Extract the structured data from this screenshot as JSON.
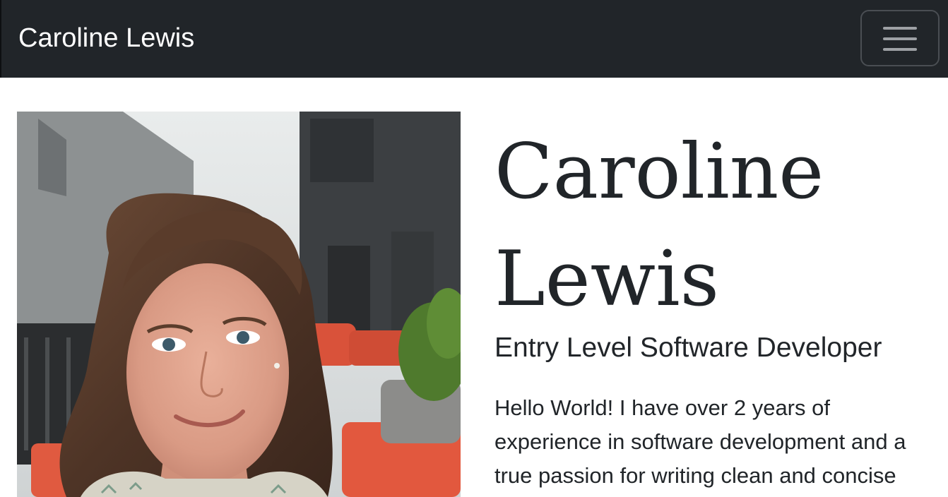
{
  "navbar": {
    "brand": "Caroline Lewis",
    "toggle_icon": "hamburger-menu-icon"
  },
  "hero": {
    "photo_alt": "Portrait of Caroline Lewis",
    "name_first": "Caroline",
    "name_last": "Lewis",
    "subtitle": "Entry Level Software Developer",
    "bio": "Hello World! I have over 2 years of experience in software development and a true passion for writing clean and concise"
  },
  "colors": {
    "navbar_bg": "#212529",
    "brand_text": "#ffffff",
    "body_text": "#212529",
    "page_bg": "#ffffff"
  }
}
